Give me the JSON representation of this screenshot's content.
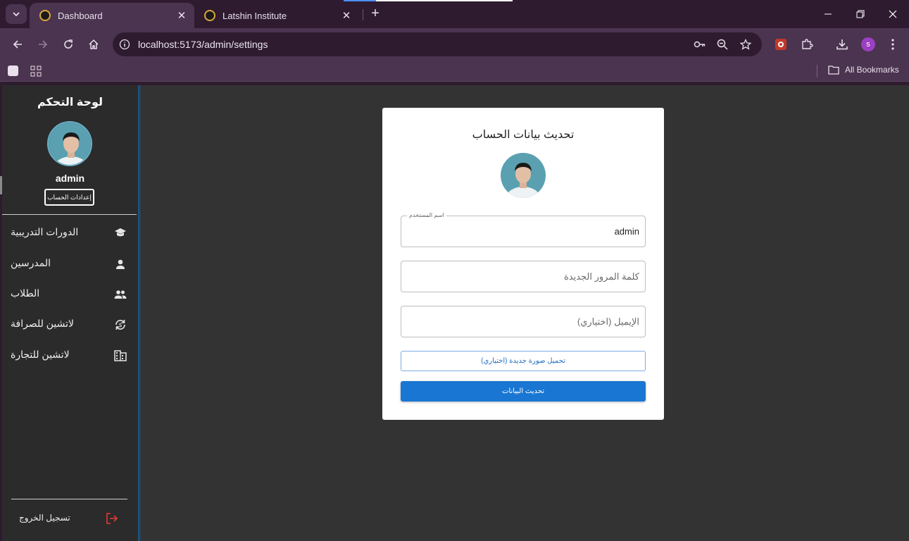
{
  "browser": {
    "tabs": [
      {
        "title": "Dashboard",
        "active": true
      },
      {
        "title": "Latshin Institute",
        "active": false
      }
    ],
    "url": "localhost:5173/admin/settings",
    "profile_initial": "s",
    "all_bookmarks_label": "All Bookmarks"
  },
  "sidebar": {
    "title": "لوحة التحكم",
    "username": "admin",
    "settings_button": "إعدادات الحساب",
    "nav": [
      {
        "label": "الدورات التدريبية",
        "icon": "school-icon"
      },
      {
        "label": "المدرسين",
        "icon": "person-icon"
      },
      {
        "label": "الطلاب",
        "icon": "people-icon"
      },
      {
        "label": "لاتشين للصرافة",
        "icon": "currency-exchange-icon"
      },
      {
        "label": "لاتشين للتجارة",
        "icon": "business-icon"
      }
    ],
    "logout_label": "تسجيل الخروج"
  },
  "form": {
    "title": "تحديث بيانات الحساب",
    "username_label": "اسم المستخدم",
    "username_value": "admin",
    "password_placeholder": "كلمة المرور الجديدة",
    "email_placeholder": "الإيميل (اختياري)",
    "upload_button": "تحميل صورة جديدة (اختياري)",
    "submit_button": "تحديث البيانات"
  },
  "colors": {
    "accent": "#1976d2",
    "logout_icon": "#e53935",
    "sidebar_bg": "#2b2b2b",
    "page_bg": "#333333"
  }
}
